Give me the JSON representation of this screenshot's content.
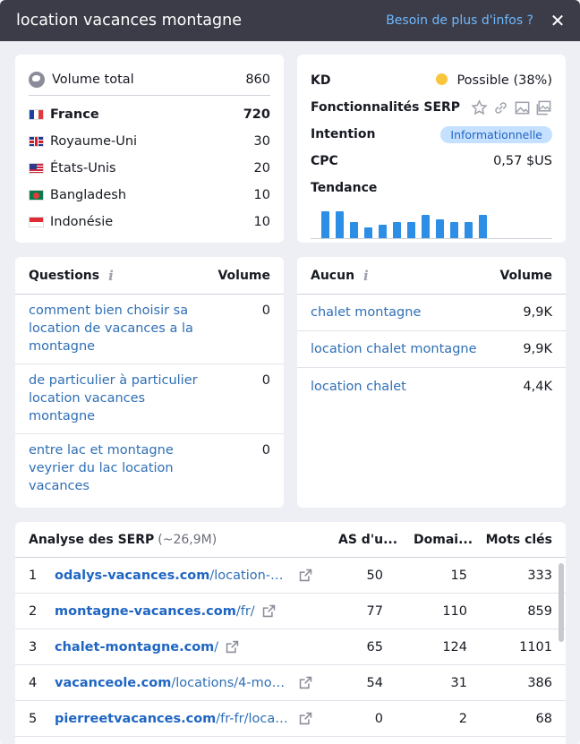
{
  "header": {
    "title": "location vacances montagne",
    "help_link": "Besoin de plus d'infos ?",
    "close_label": "✕"
  },
  "volume": {
    "total_label": "Volume total",
    "total_value": "860",
    "countries": [
      {
        "name": "France",
        "value": "720",
        "flag": "fr"
      },
      {
        "name": "Royaume-Uni",
        "value": "30",
        "flag": "uk"
      },
      {
        "name": "États-Unis",
        "value": "20",
        "flag": "us"
      },
      {
        "name": "Bangladesh",
        "value": "10",
        "flag": "bd"
      },
      {
        "name": "Indonésie",
        "value": "10",
        "flag": "id"
      }
    ]
  },
  "metrics": {
    "kd_label": "KD",
    "kd_value": "Possible (38%)",
    "kd_color": "#f9c53d",
    "serp_label": "Fonctionnalités SERP",
    "serp_icons": [
      "star-icon",
      "link-icon",
      "image-icon",
      "image-pack-icon"
    ],
    "intent_label": "Intention",
    "intent_value": "Informationnelle",
    "cpc_label": "CPC",
    "cpc_value": "0,57 $US",
    "trend_label": "Tendance",
    "trend_levels": [
      0.9,
      0.9,
      0.55,
      0.35,
      0.45,
      0.55,
      0.55,
      0.8,
      0.65,
      0.55,
      0.55,
      0.8
    ]
  },
  "questions": {
    "header": "Questions",
    "col": "Volume",
    "items": [
      {
        "text": "comment bien choisir sa location de vacances a la montagne",
        "volume": "0"
      },
      {
        "text": "de particulier à particulier location vacances montagne",
        "volume": "0"
      },
      {
        "text": "entre lac et montagne veyrier du lac location vacances",
        "volume": "0"
      }
    ]
  },
  "related": {
    "header": "Aucun",
    "col": "Volume",
    "items": [
      {
        "text": "chalet montagne",
        "volume": "9,9K"
      },
      {
        "text": "location chalet montagne",
        "volume": "9,9K"
      },
      {
        "text": "location chalet",
        "volume": "4,4K"
      }
    ]
  },
  "serp": {
    "title": "Analyse des SERP",
    "count": "(~26,9M)",
    "col_as": "AS d'u...",
    "col_domains": "Domai...",
    "col_keywords": "Mots clés",
    "rows": [
      {
        "idx": "1",
        "domain": "odalys-vacances.com",
        "path": "/location-mo...",
        "as": "50",
        "domains": "15",
        "keywords": "333"
      },
      {
        "idx": "2",
        "domain": "montagne-vacances.com",
        "path": "/fr/",
        "as": "77",
        "domains": "110",
        "keywords": "859"
      },
      {
        "idx": "3",
        "domain": "chalet-montagne.com",
        "path": "/",
        "as": "65",
        "domains": "124",
        "keywords": "1101"
      },
      {
        "idx": "4",
        "domain": "vacanceole.com",
        "path": "/locations/4-mont...",
        "as": "54",
        "domains": "31",
        "keywords": "386"
      },
      {
        "idx": "5",
        "domain": "pierreetvacances.com",
        "path": "/fr-fr/locatio...",
        "as": "0",
        "domains": "2",
        "keywords": "68"
      }
    ]
  }
}
